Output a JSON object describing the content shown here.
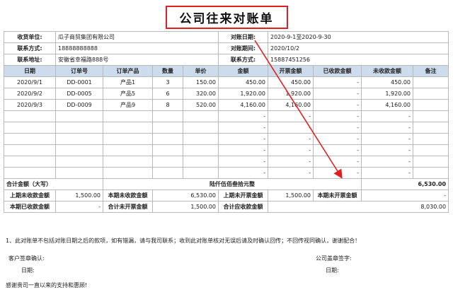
{
  "title": "公司往来对账单",
  "info": {
    "customer_label": "收货单位:",
    "customer": "瓜子商贸集团有限公司",
    "recon_date_label": "对账日期:",
    "recon_date": "2020-9-1至2020-9-30",
    "contact_label": "联系方式:",
    "contact": "18888888888",
    "period_label": "对账期间:",
    "period": "2020/10/2",
    "address_label": "联系地址:",
    "address": "安徽省幸福路888号",
    "contact2_label": "联系方式:",
    "contact2": "15887451256"
  },
  "columns": [
    "日期",
    "订单号",
    "订单产品",
    "数量",
    "单价",
    "金额",
    "开票金额",
    "已收款金额",
    "未收款金额",
    "备注"
  ],
  "rows": [
    [
      "2020/9/1",
      "DD-0001",
      "产品1",
      "3",
      "150.00",
      "450.00",
      "450.00",
      "-",
      "450.00",
      ""
    ],
    [
      "2020/9/2",
      "DD-0005",
      "产品5",
      "6",
      "320.00",
      "1,920.00",
      "1,920.00",
      "-",
      "1,920.00",
      ""
    ],
    [
      "2020/9/3",
      "DD-0009",
      "产品9",
      "8",
      "520.00",
      "4,160.00",
      "4,160.00",
      "-",
      "4,160.00",
      ""
    ],
    [
      "",
      "",
      "",
      "",
      "",
      "-",
      "-",
      "-",
      "-",
      ""
    ],
    [
      "",
      "",
      "",
      "",
      "",
      "-",
      "-",
      "-",
      "-",
      ""
    ],
    [
      "",
      "",
      "",
      "",
      "",
      "-",
      "-",
      "-",
      "-",
      ""
    ],
    [
      "",
      "",
      "",
      "",
      "",
      "-",
      "-",
      "-",
      "-",
      ""
    ],
    [
      "",
      "",
      "",
      "",
      "",
      "-",
      "-",
      "-",
      "-",
      ""
    ],
    [
      "",
      "",
      "",
      "",
      "",
      "-",
      "-",
      "-",
      "-",
      ""
    ]
  ],
  "total": {
    "label": "合计金额（大写）",
    "words": "陆仟伍佰叁拾元整",
    "amount": "6,530.00"
  },
  "summary": {
    "prev_unpaid_label": "上期未收款金额",
    "prev_unpaid": "1,500.00",
    "cur_unpaid_label": "本期未收款金额",
    "cur_unpaid": "6,530.00",
    "prev_uninv_label": "上期未开票金额",
    "prev_uninv": "1,500.00",
    "cur_uninv_label": "本期未开票金额",
    "cur_uninv": "-",
    "cur_paid_label": "本期已收款金额",
    "cur_paid": "-",
    "total_uninv_label": "合计未开票金额",
    "total_uninv": "1,500.00",
    "total_unpaid_label": "合计应收款金额",
    "total_unpaid": "8,030.00"
  },
  "footer": {
    "note": "1、此对账单不包括对账日期之后的款项，如有错漏，请与我司联系；收到此对账单核对无误后请及时确认回传；不回传视同确认，谢谢配合！",
    "customer_sign": "客户签章确认:",
    "company_sign": "公司盖章签字:",
    "date_label_left": "日期:",
    "date_label_right": "日期:",
    "thanks": "感谢贵司一直以来的支持和惠顾!"
  },
  "colors": {
    "title_border": "#e02020",
    "header_bg": "#cddcec",
    "arrow": "#e02020",
    "grid": "#b9b9b9"
  }
}
